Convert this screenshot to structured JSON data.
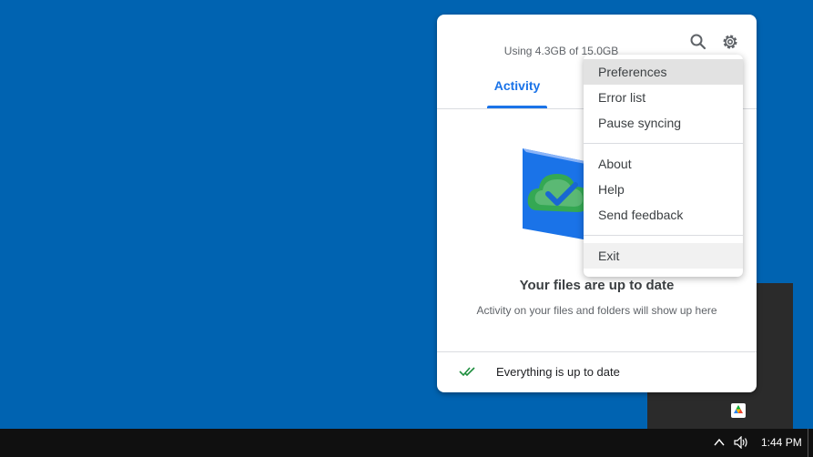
{
  "drive_panel": {
    "usage_text": "Using 4.3GB of 15.0GB",
    "tabs": [
      {
        "label": "Activity",
        "selected": true
      }
    ],
    "status_title": "Your files are up to date",
    "status_subtitle": "Activity on your files and folders will show up here",
    "footer_status": "Everything is up to date",
    "icons": {
      "search": "search-icon",
      "settings": "gear-icon",
      "footer": "double-check-icon"
    },
    "accent_color": "#1a73e8"
  },
  "settings_menu": {
    "groups": [
      [
        "Preferences",
        "Error list",
        "Pause syncing"
      ],
      [
        "About",
        "Help",
        "Send feedback"
      ],
      [
        "Exit"
      ]
    ],
    "highlighted": "Preferences"
  },
  "taskbar": {
    "time": "1:44 PM",
    "icons": [
      "chevron-up-icon",
      "volume-icon"
    ]
  },
  "desktop": {
    "background_color": "#0063b1"
  }
}
